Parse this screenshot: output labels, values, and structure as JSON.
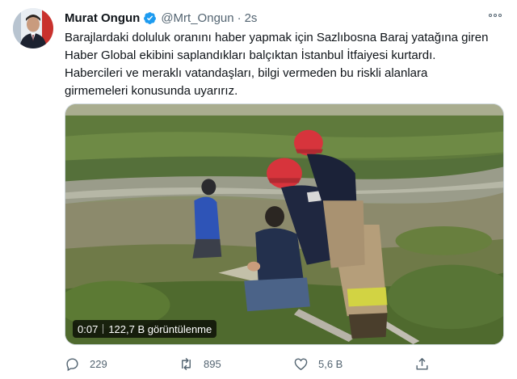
{
  "tweet": {
    "author": {
      "display_name": "Murat Ongun",
      "handle": "@Mrt_Ongun",
      "verified": true,
      "avatar_icon": "profile-photo"
    },
    "separator": "·",
    "timestamp": "2s",
    "text_lines": [
      "Barajlardaki doluluk oranını haber yapmak için Sazlıbosna Baraj yatağına giren",
      "Haber Global ekibini saplandıkları balçıktan İstanbul İtfaiyesi kurtardı.",
      "Habercileri ve meraklı vatandaşları, bilgi vermeden bu riskli alanlara",
      "girmemeleri konusunda uyarırız."
    ],
    "media": {
      "type": "video",
      "duration": "0:07",
      "views": "122,7 B görüntülenme"
    },
    "actions": {
      "reply": {
        "icon": "reply-icon",
        "count": "229"
      },
      "retweet": {
        "icon": "retweet-icon",
        "count": "895"
      },
      "like": {
        "icon": "heart-icon",
        "count": "5,6 B"
      },
      "share": {
        "icon": "share-icon"
      }
    }
  },
  "colors": {
    "verified_blue": "#1d9bf0",
    "text_primary": "#0f1419",
    "text_secondary": "#536471",
    "border": "#cfd9de"
  }
}
